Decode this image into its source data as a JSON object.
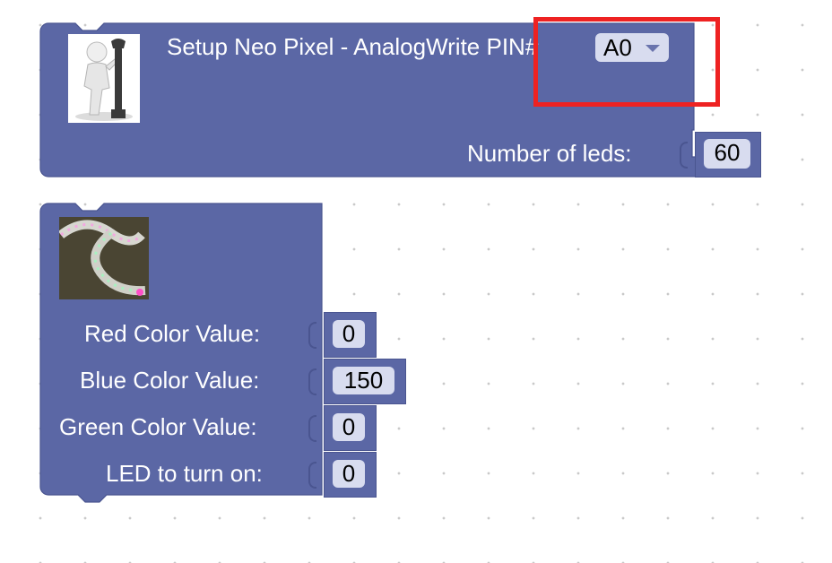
{
  "setup_block": {
    "title": "Setup Neo Pixel - AnalogWrite PIN#",
    "pin_value": "A0",
    "leds_label": "Number of leds:",
    "leds_value": "60",
    "icon": "person-with-wrench-icon"
  },
  "color_block": {
    "image": "led-strip-photo",
    "rows": [
      {
        "label": "Red Color Value:",
        "value": "0"
      },
      {
        "label": "Blue Color Value:",
        "value": "150"
      },
      {
        "label": "Green Color Value:",
        "value": "0"
      },
      {
        "label": "LED to turn on:",
        "value": "0"
      }
    ]
  },
  "colors": {
    "block": "#5b67a5",
    "field": "#d8dcef",
    "highlight": "#ee2222"
  }
}
